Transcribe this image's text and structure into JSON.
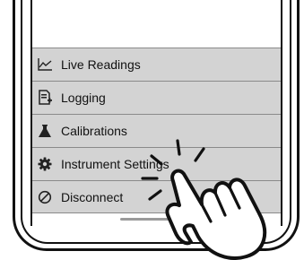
{
  "menu": {
    "items": [
      {
        "label": "Live Readings",
        "icon": "chart-line-icon"
      },
      {
        "label": "Logging",
        "icon": "document-add-icon"
      },
      {
        "label": "Calibrations",
        "icon": "flask-icon"
      },
      {
        "label": "Instrument Settings",
        "icon": "gear-icon"
      },
      {
        "label": "Disconnect",
        "icon": "disconnect-icon"
      }
    ]
  },
  "colors": {
    "menu_background": "#d3d3d3",
    "divider": "#8a8a8a",
    "frame": "#111111"
  },
  "overlay": {
    "icon": "tapping-hand-icon"
  }
}
